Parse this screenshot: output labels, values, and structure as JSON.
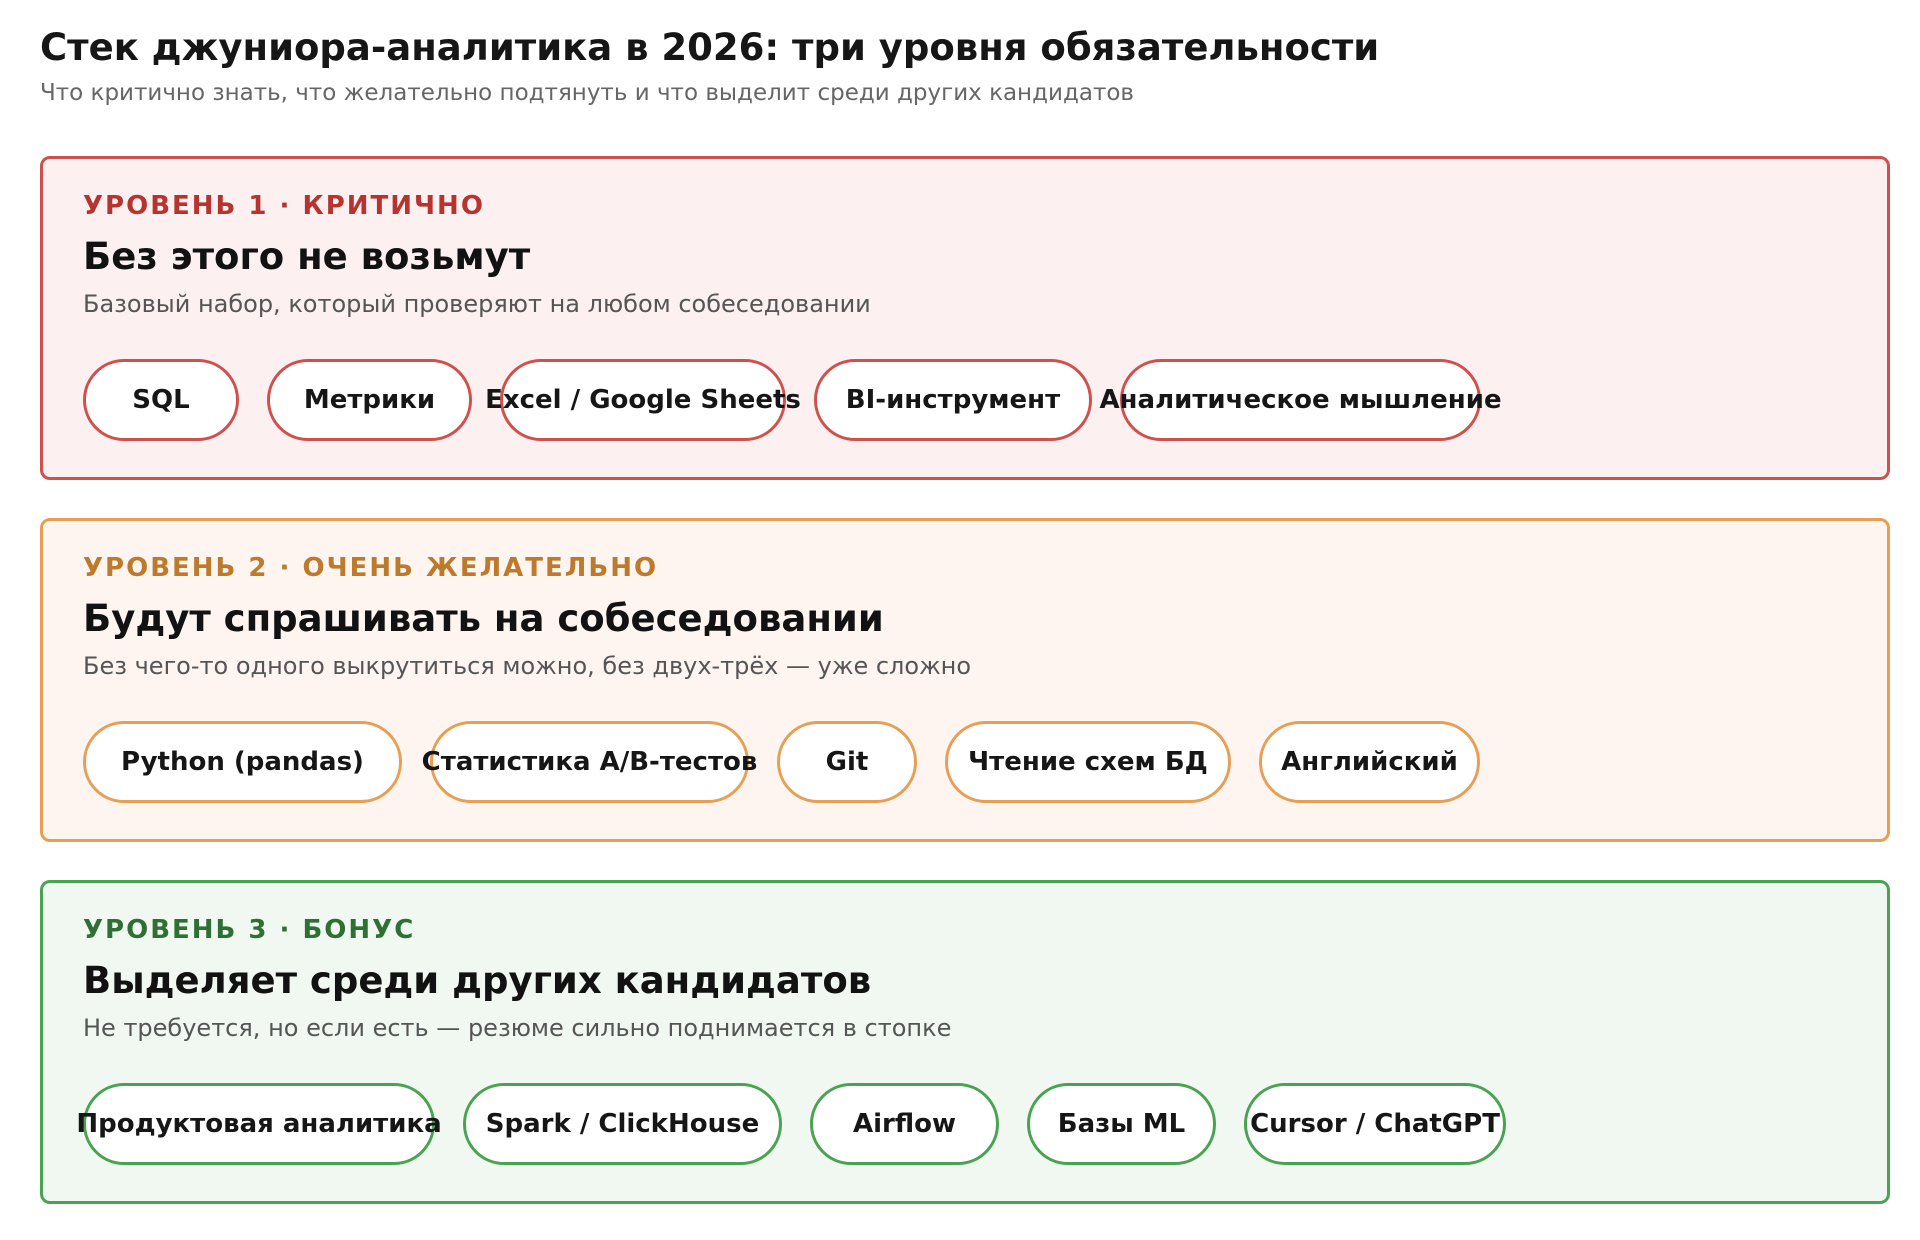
{
  "title": "Стек джуниора-аналитика в 2026: три уровня обязательности",
  "subtitle": "Что критично знать, что желательно подтянуть и что выделит среди других кандидатов",
  "colors": {
    "tier1_border": "#cf514d",
    "tier1_label": "#b5342f",
    "tier2_border": "#e6a055",
    "tier2_label": "#bd7a2c",
    "tier3_border": "#4aa352",
    "tier3_label": "#2e6f34"
  },
  "tiers": [
    {
      "label": "УРОВЕНЬ 1 · КРИТИЧНО",
      "heading": "Без этого не возьмут",
      "description": "Базовый набор, который проверяют на любом собеседовании",
      "skills": [
        "SQL",
        "Метрики",
        "Excel / Google Sheets",
        "BI-инструмент",
        "Аналитическое мышление"
      ]
    },
    {
      "label": "УРОВЕНЬ 2 · ОЧЕНЬ ЖЕЛАТЕЛЬНО",
      "heading": "Будут спрашивать на собеседовании",
      "description": "Без чего-то одного выкрутиться можно, без двух-трёх — уже сложно",
      "skills": [
        "Python (pandas)",
        "Статистика A/B-тестов",
        "Git",
        "Чтение схем БД",
        "Английский"
      ]
    },
    {
      "label": "УРОВЕНЬ 3 · БОНУС",
      "heading": "Выделяет среди других кандидатов",
      "description": "Не требуется, но если есть — резюме сильно поднимается в стопке",
      "skills": [
        "Продуктовая аналитика",
        "Spark / ClickHouse",
        "Airflow",
        "Базы ML",
        "Cursor / ChatGPT"
      ]
    }
  ]
}
